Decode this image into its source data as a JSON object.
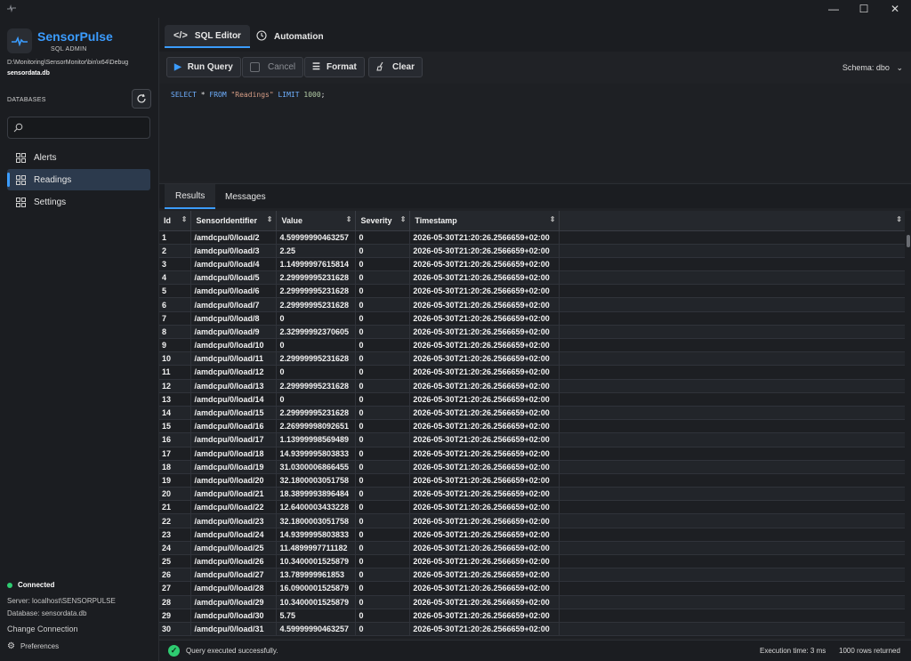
{
  "window": {
    "minimize": "—",
    "maximize": "☐",
    "close": "✕"
  },
  "brand": {
    "name": "SensorPulse",
    "subtitle": "SQL ADMIN"
  },
  "connection_path": "D:\\Monitoring\\SensorMonitor\\bin\\x64\\Debug",
  "db_file": "sensordata.db",
  "sidebar": {
    "section_label": "DATABASES",
    "search_placeholder": "",
    "items": [
      {
        "label": "Alerts",
        "active": false
      },
      {
        "label": "Readings",
        "active": true
      },
      {
        "label": "Settings",
        "active": false
      }
    ],
    "status": "Connected",
    "server": "Server: localhost\\SENSORPULSE",
    "database": "Database: sensordata.db",
    "change_connection": "Change Connection",
    "preferences": "Preferences"
  },
  "tabs": [
    {
      "label": "SQL Editor",
      "icon": "code-icon"
    },
    {
      "label": "Automation",
      "icon": "clock-icon"
    }
  ],
  "toolbar": {
    "run": "Run Query",
    "cancel": "Cancel",
    "format": "Format",
    "clear": "Clear",
    "schema": "Schema: dbo"
  },
  "editor": {
    "kw_select": "SELECT",
    "star": "*",
    "kw_from": "FROM",
    "table": "\"Readings\"",
    "kw_limit": "LIMIT",
    "limit": "1000",
    "semicolon": ";"
  },
  "results_tabs": [
    "Results",
    "Messages"
  ],
  "grid": {
    "columns": [
      "Id",
      "SensorIdentifier",
      "Value",
      "Severity",
      "Timestamp",
      ""
    ],
    "rows": [
      [
        "1",
        "/amdcpu/0/load/2",
        "4.59999990463257",
        "0",
        "2026-05-30T21:20:26.2566659+02:00"
      ],
      [
        "2",
        "/amdcpu/0/load/3",
        "2.25",
        "0",
        "2026-05-30T21:20:26.2566659+02:00"
      ],
      [
        "3",
        "/amdcpu/0/load/4",
        "1.14999997615814",
        "0",
        "2026-05-30T21:20:26.2566659+02:00"
      ],
      [
        "4",
        "/amdcpu/0/load/5",
        "2.29999995231628",
        "0",
        "2026-05-30T21:20:26.2566659+02:00"
      ],
      [
        "5",
        "/amdcpu/0/load/6",
        "2.29999995231628",
        "0",
        "2026-05-30T21:20:26.2566659+02:00"
      ],
      [
        "6",
        "/amdcpu/0/load/7",
        "2.29999995231628",
        "0",
        "2026-05-30T21:20:26.2566659+02:00"
      ],
      [
        "7",
        "/amdcpu/0/load/8",
        "0",
        "0",
        "2026-05-30T21:20:26.2566659+02:00"
      ],
      [
        "8",
        "/amdcpu/0/load/9",
        "2.32999992370605",
        "0",
        "2026-05-30T21:20:26.2566659+02:00"
      ],
      [
        "9",
        "/amdcpu/0/load/10",
        "0",
        "0",
        "2026-05-30T21:20:26.2566659+02:00"
      ],
      [
        "10",
        "/amdcpu/0/load/11",
        "2.29999995231628",
        "0",
        "2026-05-30T21:20:26.2566659+02:00"
      ],
      [
        "11",
        "/amdcpu/0/load/12",
        "0",
        "0",
        "2026-05-30T21:20:26.2566659+02:00"
      ],
      [
        "12",
        "/amdcpu/0/load/13",
        "2.29999995231628",
        "0",
        "2026-05-30T21:20:26.2566659+02:00"
      ],
      [
        "13",
        "/amdcpu/0/load/14",
        "0",
        "0",
        "2026-05-30T21:20:26.2566659+02:00"
      ],
      [
        "14",
        "/amdcpu/0/load/15",
        "2.29999995231628",
        "0",
        "2026-05-30T21:20:26.2566659+02:00"
      ],
      [
        "15",
        "/amdcpu/0/load/16",
        "2.26999998092651",
        "0",
        "2026-05-30T21:20:26.2566659+02:00"
      ],
      [
        "16",
        "/amdcpu/0/load/17",
        "1.13999998569489",
        "0",
        "2026-05-30T21:20:26.2566659+02:00"
      ],
      [
        "17",
        "/amdcpu/0/load/18",
        "14.9399995803833",
        "0",
        "2026-05-30T21:20:26.2566659+02:00"
      ],
      [
        "18",
        "/amdcpu/0/load/19",
        "31.0300006866455",
        "0",
        "2026-05-30T21:20:26.2566659+02:00"
      ],
      [
        "19",
        "/amdcpu/0/load/20",
        "32.1800003051758",
        "0",
        "2026-05-30T21:20:26.2566659+02:00"
      ],
      [
        "20",
        "/amdcpu/0/load/21",
        "18.3899993896484",
        "0",
        "2026-05-30T21:20:26.2566659+02:00"
      ],
      [
        "21",
        "/amdcpu/0/load/22",
        "12.6400003433228",
        "0",
        "2026-05-30T21:20:26.2566659+02:00"
      ],
      [
        "22",
        "/amdcpu/0/load/23",
        "32.1800003051758",
        "0",
        "2026-05-30T21:20:26.2566659+02:00"
      ],
      [
        "23",
        "/amdcpu/0/load/24",
        "14.9399995803833",
        "0",
        "2026-05-30T21:20:26.2566659+02:00"
      ],
      [
        "24",
        "/amdcpu/0/load/25",
        "11.4899997711182",
        "0",
        "2026-05-30T21:20:26.2566659+02:00"
      ],
      [
        "25",
        "/amdcpu/0/load/26",
        "10.3400001525879",
        "0",
        "2026-05-30T21:20:26.2566659+02:00"
      ],
      [
        "26",
        "/amdcpu/0/load/27",
        "13.789999961853",
        "0",
        "2026-05-30T21:20:26.2566659+02:00"
      ],
      [
        "27",
        "/amdcpu/0/load/28",
        "16.0900001525879",
        "0",
        "2026-05-30T21:20:26.2566659+02:00"
      ],
      [
        "28",
        "/amdcpu/0/load/29",
        "10.3400001525879",
        "0",
        "2026-05-30T21:20:26.2566659+02:00"
      ],
      [
        "29",
        "/amdcpu/0/load/30",
        "5.75",
        "0",
        "2026-05-30T21:20:26.2566659+02:00"
      ],
      [
        "30",
        "/amdcpu/0/load/31",
        "4.59999990463257",
        "0",
        "2026-05-30T21:20:26.2566659+02:00"
      ]
    ]
  },
  "statusbar": {
    "message": "Query executed successfully.",
    "exec_time": "Execution time: 3 ms",
    "rows": "1000 rows returned"
  },
  "colors": {
    "accent": "#3b9cff",
    "success": "#2ecc71",
    "background": "#1b1d21"
  }
}
